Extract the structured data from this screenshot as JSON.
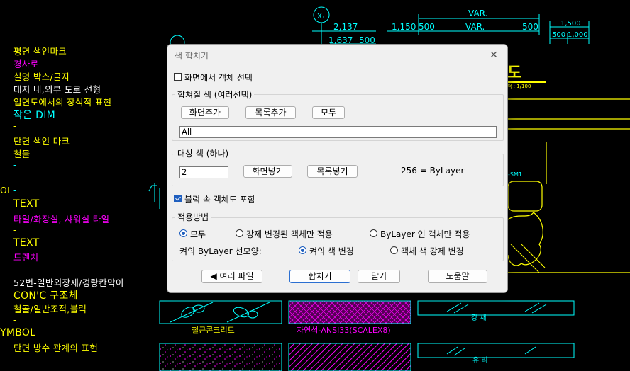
{
  "colors": {
    "yellow": "#ffff00",
    "magenta": "#ff00ff",
    "cyan": "#00ffff",
    "white": "#ffffff"
  },
  "background": {
    "left_text": [
      {
        "text": "평면 색인마크",
        "color": "yellow"
      },
      {
        "text": "경사로",
        "color": "magenta"
      },
      {
        "text": "실명 박스/글자",
        "color": "yellow"
      },
      {
        "text": "대지 내,외부 도로 선형",
        "color": "white"
      },
      {
        "text": "입면도에서의 장식적 표현",
        "color": "yellow"
      },
      {
        "text": "작은 DIM",
        "color": "cyan"
      },
      {
        "text": "-",
        "color": "yellow"
      },
      {
        "text": "단면 색인 마크",
        "color": "yellow"
      },
      {
        "text": "철물",
        "color": "yellow"
      },
      {
        "text": "-",
        "color": "cyan"
      },
      {
        "text": "-",
        "color": "cyan"
      },
      {
        "text": "-",
        "color": "cyan"
      },
      {
        "text": "TEXT",
        "color": "yellow"
      },
      {
        "text": "타일/화장실, 샤워실 타일",
        "color": "magenta"
      },
      {
        "text": "-",
        "color": "yellow"
      },
      {
        "text": "TEXT",
        "color": "yellow"
      },
      {
        "text": "트렌치",
        "color": "magenta"
      },
      {
        "text": "52번-일반외장재/경량칸막이",
        "color": "white"
      },
      {
        "text": "CON'C 구조체",
        "color": "yellow"
      },
      {
        "text": "철골/일반조적,블럭",
        "color": "yellow"
      },
      {
        "text": "-",
        "color": "yellow"
      },
      {
        "text": "단면 방수 관계의 표현",
        "color": "yellow"
      }
    ],
    "ol_label": "OL",
    "symbol_label": "YMBOL",
    "dims": {
      "x1": "X₁",
      "d2137": "2,137",
      "d1637": "1,637",
      "d500a": "500",
      "d1150": "1,150",
      "d500b": "500",
      "var1": "VAR.",
      "var2": "VAR.",
      "d500c": "500",
      "d1500": "1,500",
      "d500d": "500",
      "d1000": "1,000"
    },
    "title_glyph": "도",
    "scale_text": "척 : 1/100",
    "sm_text": "-SM1",
    "hatch_labels": {
      "concrete": "철근콘크리트",
      "ansi": "자연석-ANSI33(SCALEX8)",
      "steel": "강 재",
      "glass": "유 리"
    }
  },
  "dialog": {
    "title": "색 합치기",
    "select_on_screen": {
      "label": "화면에서 객체 선택",
      "checked": false
    },
    "merge_group": {
      "legend": "합쳐질 색 (여러선택)",
      "add_screen": "화면추가",
      "add_list": "목록추가",
      "all": "모두",
      "value": "All"
    },
    "target_group": {
      "legend": "대상 색 (하나)",
      "value": "2",
      "put_screen": "화면넣기",
      "put_list": "목록넣기",
      "info": "256 = ByLayer"
    },
    "include_block": {
      "label": "블럭 속 객체도 포함",
      "checked": true
    },
    "apply_group": {
      "legend": "적용방법",
      "options": [
        {
          "label": "모두",
          "checked": true
        },
        {
          "label": "강제 변경된 객체만 적용",
          "checked": false
        },
        {
          "label": "ByLayer 인 객체만 적용",
          "checked": false
        }
      ],
      "line_label": "켜의 ByLayer 선모양:",
      "line_options": [
        {
          "label": "켜의 색 변경",
          "checked": true
        },
        {
          "label": "객체 색 강제 변경",
          "checked": false
        }
      ]
    },
    "buttons": {
      "multi_file": "◀ 여러 파일",
      "merge": "합치기",
      "close": "닫기",
      "help": "도움말"
    }
  }
}
